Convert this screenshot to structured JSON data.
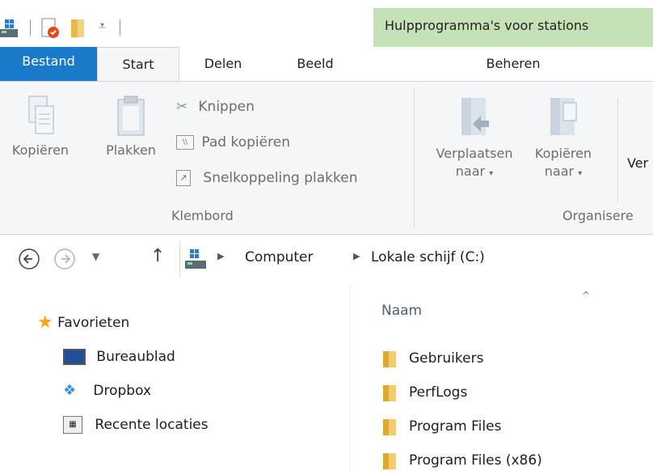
{
  "window": {
    "contextual_tab_title": "Hulpprogramma's voor stations"
  },
  "tabs": {
    "bestand": "Bestand",
    "start": "Start",
    "delen": "Delen",
    "beeld": "Beeld",
    "beheren": "Beheren"
  },
  "ribbon": {
    "clipboard": {
      "kopieren": "Kopiëren",
      "plakken": "Plakken",
      "knippen": "Knippen",
      "pad_kopieren": "Pad kopiëren",
      "snelkoppeling_plakken": "Snelkoppeling plakken",
      "group_label": "Klembord"
    },
    "organize": {
      "verplaatsen_line1": "Verplaatsen",
      "verplaatsen_line2": "naar",
      "kopieren_line1": "Kopiëren",
      "kopieren_line2": "naar",
      "partial_button": "Ver",
      "group_label": "Organisere"
    }
  },
  "address": {
    "segments": [
      "Computer",
      "Lokale schijf (C:)"
    ]
  },
  "navpane": {
    "favorites": "Favorieten",
    "items": [
      "Bureaublad",
      "Dropbox",
      "Recente locaties"
    ]
  },
  "content": {
    "column_header": "Naam",
    "files": [
      "Gebruikers",
      "PerfLogs",
      "Program Files",
      "Program Files (x86)"
    ]
  },
  "colors": {
    "bestand_tab": "#1979ca",
    "contextual": "#c5e2b6",
    "ribbon_bg": "#f5f6f7"
  }
}
